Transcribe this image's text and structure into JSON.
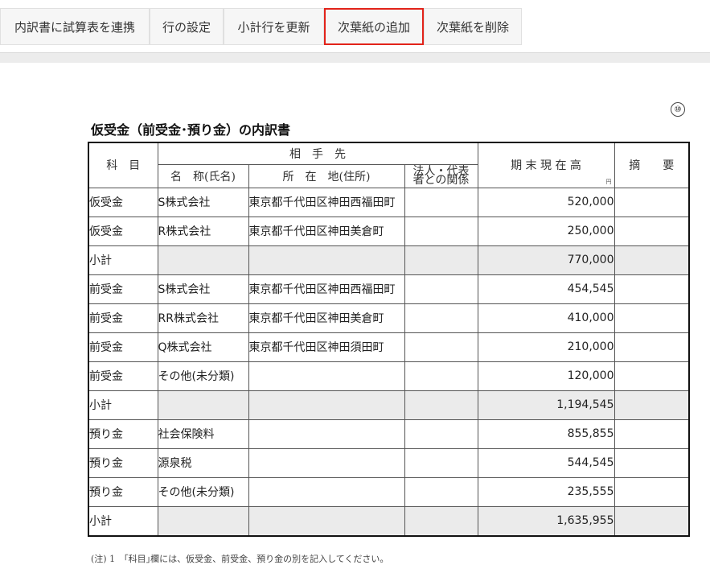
{
  "toolbar": {
    "buttons": [
      {
        "label": "内訳書に試算表を連携"
      },
      {
        "label": "行の設定"
      },
      {
        "label": "小計行を更新"
      },
      {
        "label": "次葉紙の追加"
      },
      {
        "label": "次葉紙を削除"
      }
    ],
    "active_color": "#e2231a"
  },
  "form": {
    "page_mark": "⑩",
    "title": "仮受金（前受金･預り金）の内訳書",
    "headers": {
      "subject": "科　目",
      "counterparty": "相　手　先",
      "name": "名　称(氏名)",
      "address": "所　在　地(住所)",
      "relation": "法人・代表者との関係",
      "balance": "期 末 現 在 高",
      "unit": "円",
      "remarks": "摘　　要"
    },
    "rows": [
      {
        "subject": "仮受金",
        "name": "S株式会社",
        "address": "東京都千代田区神田西福田町",
        "relation": "",
        "amount": "520,000",
        "remarks": "",
        "subtotal": false
      },
      {
        "subject": "仮受金",
        "name": "R株式会社",
        "address": "東京都千代田区神田美倉町",
        "relation": "",
        "amount": "250,000",
        "remarks": "",
        "subtotal": false
      },
      {
        "subject": "小計",
        "name": "",
        "address": "",
        "relation": "",
        "amount": "770,000",
        "remarks": "",
        "subtotal": true
      },
      {
        "subject": "前受金",
        "name": "S株式会社",
        "address": "東京都千代田区神田西福田町",
        "relation": "",
        "amount": "454,545",
        "remarks": "",
        "subtotal": false
      },
      {
        "subject": "前受金",
        "name": "RR株式会社",
        "address": "東京都千代田区神田美倉町",
        "relation": "",
        "amount": "410,000",
        "remarks": "",
        "subtotal": false
      },
      {
        "subject": "前受金",
        "name": "Q株式会社",
        "address": "東京都千代田区神田須田町",
        "relation": "",
        "amount": "210,000",
        "remarks": "",
        "subtotal": false
      },
      {
        "subject": "前受金",
        "name": "その他(未分類)",
        "address": "",
        "relation": "",
        "amount": "120,000",
        "remarks": "",
        "subtotal": false
      },
      {
        "subject": "小計",
        "name": "",
        "address": "",
        "relation": "",
        "amount": "1,194,545",
        "remarks": "",
        "subtotal": true
      },
      {
        "subject": "預り金",
        "name": "社会保険料",
        "address": "",
        "relation": "",
        "amount": "855,855",
        "remarks": "",
        "subtotal": false
      },
      {
        "subject": "預り金",
        "name": "源泉税",
        "address": "",
        "relation": "",
        "amount": "544,545",
        "remarks": "",
        "subtotal": false
      },
      {
        "subject": "預り金",
        "name": "その他(未分類)",
        "address": "",
        "relation": "",
        "amount": "235,555",
        "remarks": "",
        "subtotal": false
      },
      {
        "subject": "小計",
        "name": "",
        "address": "",
        "relation": "",
        "amount": "1,635,955",
        "remarks": "",
        "subtotal": true
      }
    ],
    "footnote": "(注) 1　｢科目｣欄には、仮受金、前受金、預り金の別を記入してください。"
  }
}
